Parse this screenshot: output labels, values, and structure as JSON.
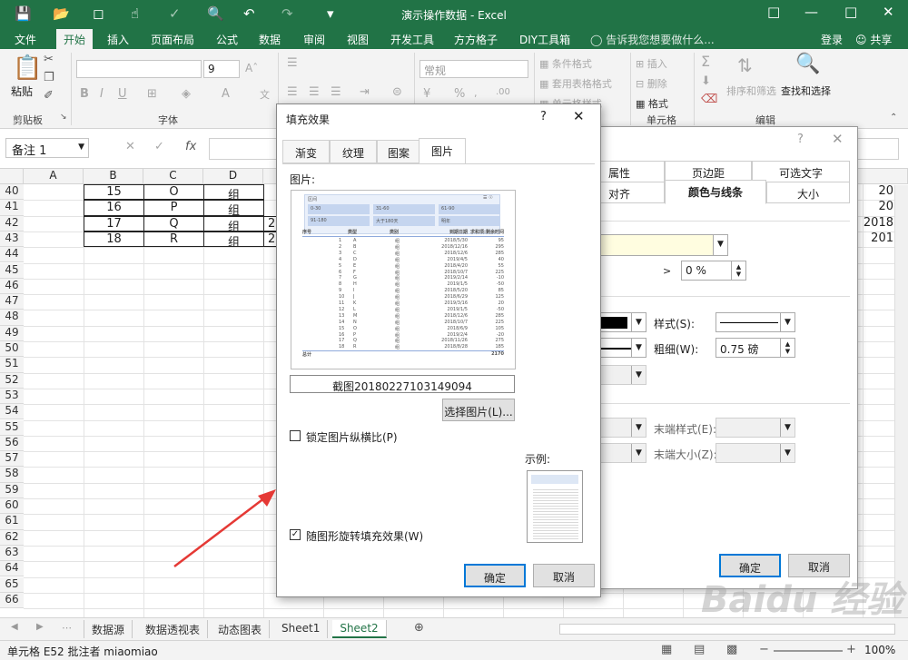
{
  "titlebar": {
    "title": "演示操作数据 - Excel",
    "undo_icon": "undo-icon",
    "redo_icon": "redo-icon"
  },
  "menu": {
    "items": [
      "文件",
      "开始",
      "插入",
      "页面布局",
      "公式",
      "数据",
      "审阅",
      "视图",
      "开发工具",
      "方方格子",
      "DIY工具箱"
    ],
    "tell_me": "告诉我您想要做什么...",
    "login": "登录",
    "share": "共享"
  },
  "ribbon": {
    "paste": "粘贴",
    "clipboard": "剪贴板",
    "font_group": "字体",
    "font_size": "9",
    "number_format": "常规",
    "cond_format": "条件格式",
    "table_format": "套用表格格式",
    "cell_style": "单元格样式",
    "insert": "插入",
    "delete": "删除",
    "format": "格式",
    "cells_group": "单元格",
    "sort_filter": "排序和筛选",
    "find_select": "查找和选择",
    "edit_group": "编辑"
  },
  "formula_bar": {
    "name_box": "备注 1",
    "fx": "fx"
  },
  "grid": {
    "columns": [
      "A",
      "B",
      "C",
      "D"
    ],
    "rows": [
      "40",
      "41",
      "42",
      "43",
      "44",
      "45",
      "46",
      "47",
      "48",
      "49",
      "50",
      "51",
      "52",
      "53",
      "54",
      "55",
      "56",
      "57",
      "58",
      "59",
      "60",
      "61",
      "62",
      "63",
      "64",
      "65",
      "66"
    ],
    "data": [
      [
        "15",
        "O",
        "组"
      ],
      [
        "16",
        "P",
        "组"
      ],
      [
        "17",
        "Q",
        "组"
      ],
      [
        "18",
        "R",
        "组"
      ]
    ],
    "partial_d": [
      "2",
      "2"
    ],
    "right_col": [
      "20",
      "20",
      "2018",
      "201"
    ]
  },
  "sheets": {
    "tabs": [
      "数据源",
      "数据透视表",
      "动态图表",
      "Sheet1",
      "Sheet2"
    ],
    "active": "Sheet2"
  },
  "status": {
    "text": "单元格 E52 批注者 miaomiao",
    "zoom": "100%"
  },
  "back_dialog": {
    "tabs_row1": [
      "属性",
      "页边距",
      "可选文字"
    ],
    "tabs_row2": [
      "对齐",
      "颜色与线条",
      "大小"
    ],
    "transparency": "0 %",
    "style_label": "样式(S):",
    "weight_label": "粗细(W):",
    "weight_value": "0.75 磅",
    "end_style": "末端样式(E):",
    "end_size": "末端大小(Z):",
    "ok": "确定",
    "cancel": "取消"
  },
  "front_dialog": {
    "title": "填充效果",
    "tabs": [
      "渐变",
      "纹理",
      "图案",
      "图片"
    ],
    "picture_label": "图片:",
    "filename": "截图20180227103149094",
    "select_picture": "选择图片(L)...",
    "lock_ratio": "锁定图片纵横比(P)",
    "rotate_with_shape": "随图形旋转填充效果(W)",
    "sample_label": "示例:",
    "ok": "确定",
    "cancel": "取消",
    "preview": {
      "filter_header": "区间",
      "filter_buttons": [
        "0-30",
        "31-60",
        "61-90",
        "91-180",
        "大于180天",
        "明年"
      ],
      "headers": [
        "序号",
        "类型",
        "类别",
        "到期日期",
        "求和项:剩余时间"
      ],
      "rows": [
        [
          "1",
          "A",
          "组",
          "2018/5/30",
          "95"
        ],
        [
          "2",
          "B",
          "组",
          "2018/12/16",
          "295"
        ],
        [
          "3",
          "C",
          "组",
          "2018/12/6",
          "285"
        ],
        [
          "4",
          "D",
          "组",
          "2019/4/5",
          "40"
        ],
        [
          "5",
          "E",
          "组",
          "2018/4/20",
          "55"
        ],
        [
          "6",
          "F",
          "组",
          "2018/10/7",
          "225"
        ],
        [
          "7",
          "G",
          "组",
          "2019/2/14",
          "-10"
        ],
        [
          "8",
          "H",
          "组",
          "2019/1/5",
          "-50"
        ],
        [
          "9",
          "I",
          "组",
          "2018/5/20",
          "85"
        ],
        [
          "10",
          "J",
          "组",
          "2018/6/29",
          "125"
        ],
        [
          "11",
          "K",
          "组",
          "2019/3/16",
          "20"
        ],
        [
          "12",
          "L",
          "组",
          "2019/1/5",
          "-50"
        ],
        [
          "13",
          "M",
          "组",
          "2018/12/6",
          "285"
        ],
        [
          "14",
          "N",
          "组",
          "2018/10/7",
          "225"
        ],
        [
          "15",
          "O",
          "组",
          "2018/6/9",
          "105"
        ],
        [
          "16",
          "P",
          "组",
          "2019/2/4",
          "-20"
        ],
        [
          "17",
          "Q",
          "组",
          "2018/11/26",
          "275"
        ],
        [
          "18",
          "R",
          "组",
          "2018/8/28",
          "185"
        ]
      ],
      "total_label": "总计",
      "total_value": "2170"
    }
  },
  "watermark": "Baidu 经验"
}
